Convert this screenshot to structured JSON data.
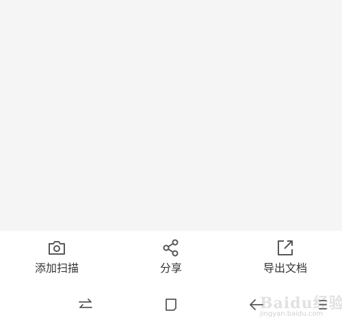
{
  "actions": [
    {
      "label": "添加扫描",
      "icon": "camera-icon"
    },
    {
      "label": "分享",
      "icon": "share-icon"
    },
    {
      "label": "导出文档",
      "icon": "export-icon"
    }
  ],
  "nav": {
    "switch_icon": "swap-arrows-icon",
    "home_icon": "square-home-icon",
    "back_icon": "back-arrow-icon",
    "menu_icon": "menu-lines-icon"
  },
  "watermark": {
    "main": "Baidu经验",
    "sub": "jingyan.baidu.com"
  },
  "colors": {
    "content_bg": "#f5f5f5",
    "toolbar_bg": "#ffffff",
    "icon_color": "#555555",
    "label_color": "#333333"
  }
}
